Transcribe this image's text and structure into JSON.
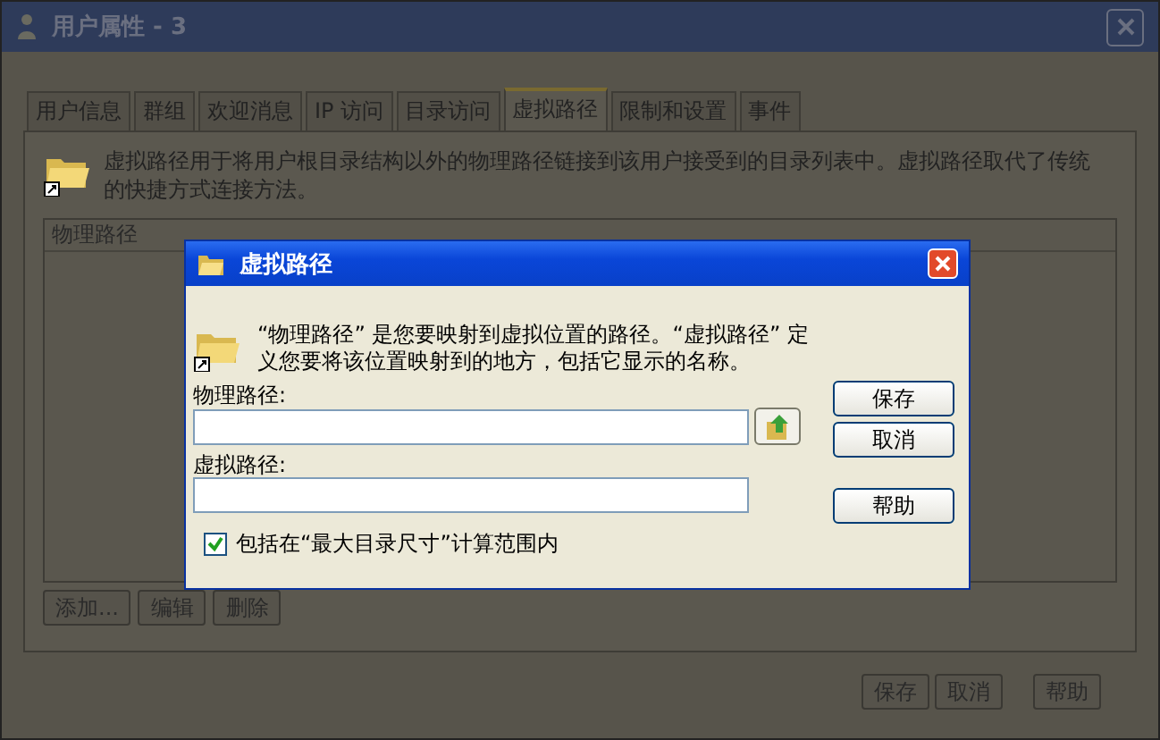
{
  "window": {
    "title": "用户属性 - 3"
  },
  "tabs": [
    {
      "label": "用户信息",
      "selected": false
    },
    {
      "label": "群组",
      "selected": false
    },
    {
      "label": "欢迎消息",
      "selected": false
    },
    {
      "label": "IP 访问",
      "selected": false
    },
    {
      "label": "目录访问",
      "selected": false
    },
    {
      "label": "虚拟路径",
      "selected": true
    },
    {
      "label": "限制和设置",
      "selected": false
    },
    {
      "label": "事件",
      "selected": false
    }
  ],
  "description": "虚拟路径用于将用户根目录结构以外的物理路径链接到该用户接受到的目录列表中。虚拟路径取代了传统的快捷方式连接方法。",
  "list": {
    "columns": [
      "物理路径"
    ]
  },
  "list_buttons": [
    "添加...",
    "编辑",
    "删除"
  ],
  "footer_buttons": [
    "保存",
    "取消",
    "帮助"
  ],
  "dialog": {
    "title": "虚拟路径",
    "description": "“物理路径” 是您要映射到虚拟位置的路径。“虚拟路径” 定义您要将该位置映射到的地方，包括它显示的名称。",
    "fields": [
      {
        "label": "物理路径:",
        "kind": "browse"
      },
      {
        "label": "虚拟路径:",
        "kind": "plain"
      }
    ],
    "checkbox": {
      "label": "包括在“最大目录尺寸”计算范围内",
      "checked": true
    },
    "buttons": [
      "保存",
      "取消",
      "帮助"
    ]
  }
}
